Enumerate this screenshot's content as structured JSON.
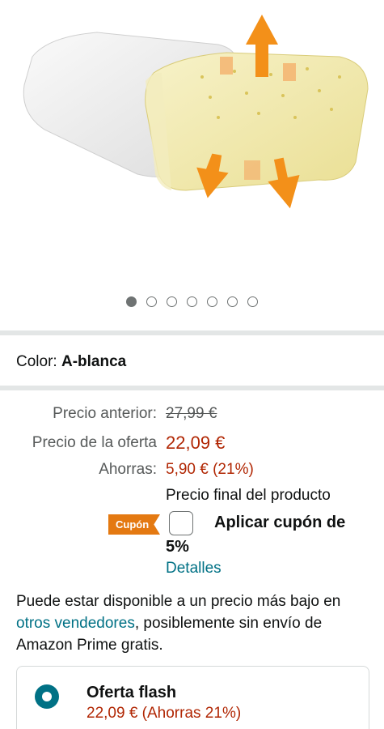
{
  "product_image": {
    "dots_total": 7,
    "active_dot": 0
  },
  "color": {
    "label": "Color:",
    "value": "A-blanca"
  },
  "pricing": {
    "previous_label": "Precio anterior:",
    "previous_value": "27,99 €",
    "deal_label": "Precio de la oferta",
    "deal_value": "22,09 €",
    "savings_label": "Ahorras:",
    "savings_value": "5,90 € (21%)",
    "final_note": "Precio final del producto"
  },
  "coupon": {
    "badge": "Cupón",
    "apply_text": "Aplicar cupón de",
    "percent": "5%",
    "details_link": "Detalles"
  },
  "availability": {
    "text_before": "Puede estar disponible a un precio más bajo en ",
    "link": "otros vendedores",
    "text_after": ", posiblemente sin envío de Amazon Prime gratis."
  },
  "flash_offer": {
    "title": "Oferta flash",
    "price": "22,09 € (Ahorras 21%)",
    "selected": true
  },
  "colors": {
    "deal_red": "#b12704",
    "link_teal": "#007185",
    "coupon_orange": "#e47911",
    "arrow_orange": "#f39019"
  }
}
